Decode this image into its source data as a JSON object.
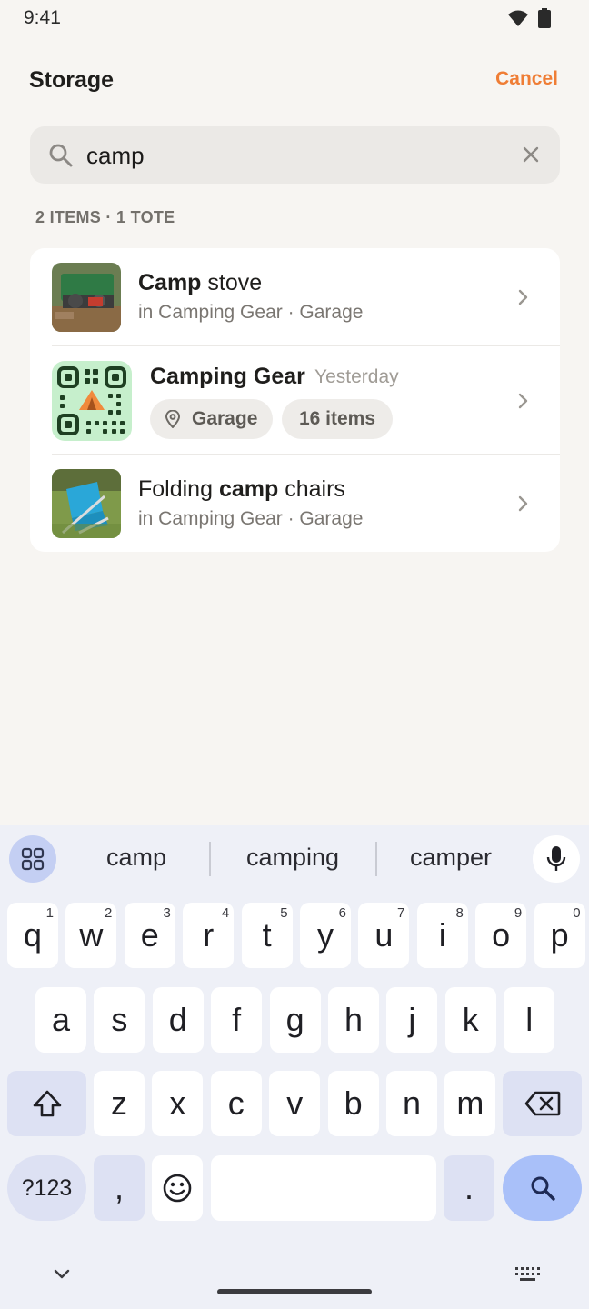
{
  "status": {
    "time": "9:41"
  },
  "header": {
    "title": "Storage",
    "cancel_label": "Cancel"
  },
  "search": {
    "value": "camp",
    "placeholder": ""
  },
  "results": {
    "count_label": "2 ITEMS · 1 TOTE",
    "rows": [
      {
        "title_bold": "Camp",
        "title_rest": " stove",
        "subtitle": "in Camping Gear · Garage"
      },
      {
        "title": "Camping Gear",
        "date": "Yesterday",
        "location_chip": "Garage",
        "count_chip": "16 items"
      },
      {
        "title_pre": "Folding ",
        "title_bold": "camp",
        "title_rest": " chairs",
        "subtitle": "in Camping Gear · Garage"
      }
    ]
  },
  "keyboard": {
    "suggestions": [
      "camp",
      "camping",
      "camper"
    ],
    "row1": [
      {
        "k": "q",
        "h": "1"
      },
      {
        "k": "w",
        "h": "2"
      },
      {
        "k": "e",
        "h": "3"
      },
      {
        "k": "r",
        "h": "4"
      },
      {
        "k": "t",
        "h": "5"
      },
      {
        "k": "y",
        "h": "6"
      },
      {
        "k": "u",
        "h": "7"
      },
      {
        "k": "i",
        "h": "8"
      },
      {
        "k": "o",
        "h": "9"
      },
      {
        "k": "p",
        "h": "0"
      }
    ],
    "row2": [
      "a",
      "s",
      "d",
      "f",
      "g",
      "h",
      "j",
      "k",
      "l"
    ],
    "row3": [
      "z",
      "x",
      "c",
      "v",
      "b",
      "n",
      "m"
    ],
    "symbols_label": "?123",
    "comma_label": ",",
    "period_label": "."
  },
  "colors": {
    "accent": "#ef7d35",
    "background": "#f7f5f2",
    "keyboard_bg": "#eef0f7",
    "search_key": "#a9c0f9"
  }
}
